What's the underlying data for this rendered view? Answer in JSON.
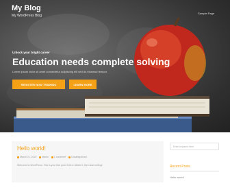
{
  "site": {
    "title": "My Blog",
    "description": "My WordPress Blog"
  },
  "nav": {
    "items": [
      "Sample Page"
    ]
  },
  "hero": {
    "kicker": "Unlock your bright career",
    "heading": "Education needs complete solving",
    "subtext": "Lorem ipsum dolor sit amet consectetur adipiscing elit sed do eiusmod tempor",
    "button_primary": "REGISTER NOW TRAINING",
    "button_secondary": "LEARN MORE"
  },
  "post": {
    "title": "Hello world!",
    "meta": {
      "date": "March 21, 2020",
      "author": "admin",
      "comments": "1 comment",
      "category": "Uncategorized"
    },
    "excerpt": "Welcome to WordPress. This is your first post. Edit or delete it, then start writing!"
  },
  "sidebar": {
    "search_placeholder": "Enter keyword here",
    "recent_heading": "Recent Posts",
    "recent_items": [
      "Hello world!"
    ]
  },
  "colors": {
    "accent": "#f4a118"
  }
}
